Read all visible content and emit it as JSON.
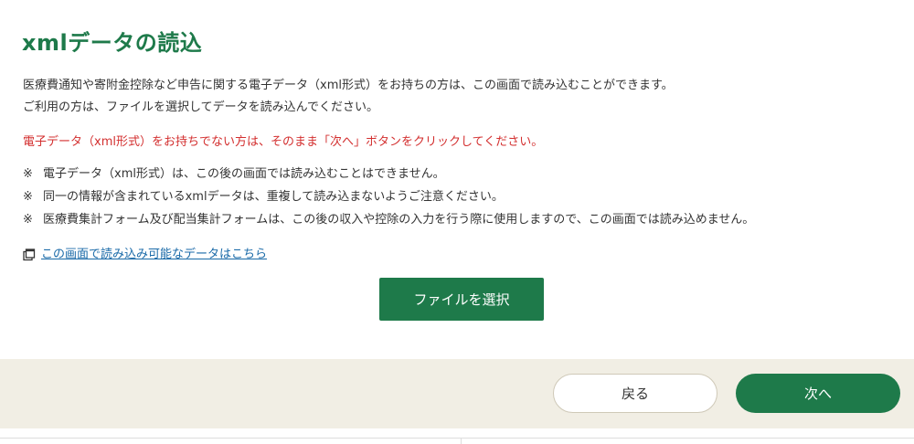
{
  "page": {
    "title": "xmlデータの読込"
  },
  "intro": {
    "line1": "医療費通知や寄附金控除など申告に関する電子データ（xml形式）をお持ちの方は、この画面で読み込むことができます。",
    "line2": "ご利用の方は、ファイルを選択してデータを読み込んでください。"
  },
  "warning": {
    "text": "電子データ（xml形式）をお持ちでない方は、そのまま「次へ」ボタンをクリックしてください。"
  },
  "notes": {
    "mark": "※",
    "items": [
      "電子データ（xml形式）は、この後の画面では読み込むことはできません。",
      "同一の情報が含まれているxmlデータは、重複して読み込まないようご注意ください。",
      "医療費集計フォーム及び配当集計フォームは、この後の収入や控除の入力を行う際に使用しますので、この画面では読み込めません。"
    ]
  },
  "link": {
    "text": "この画面で読み込み可能なデータはこちら",
    "icon": "new-window-icon"
  },
  "buttons": {
    "select_file": "ファイルを選択",
    "back": "戻る",
    "next": "次へ"
  },
  "colors": {
    "brand_green": "#1e7a4a",
    "warning_red": "#d32f2f",
    "link_blue": "#1a6aa8",
    "footer_beige": "#f1eee4"
  }
}
